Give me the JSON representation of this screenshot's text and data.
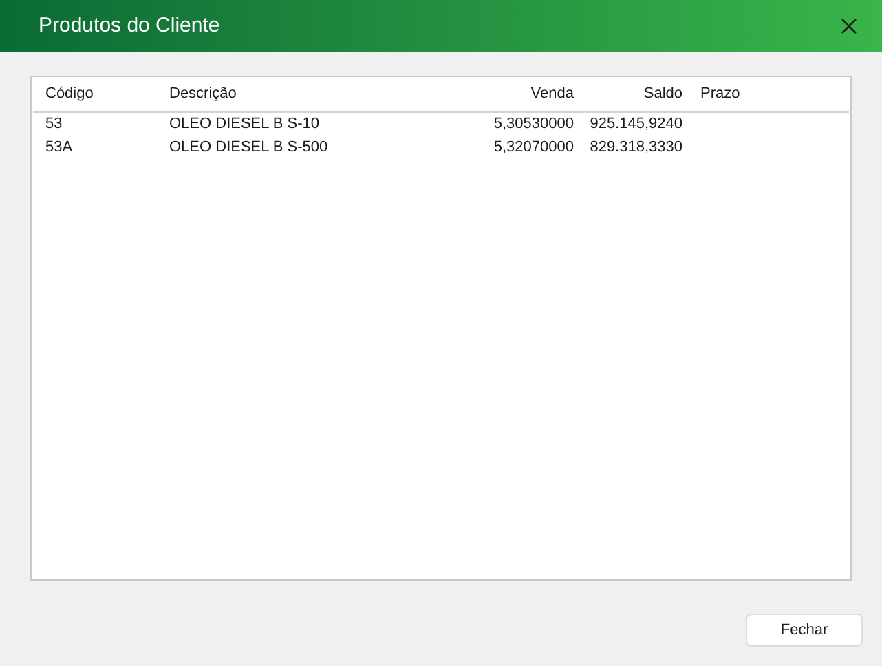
{
  "window": {
    "title": "Produtos do Cliente"
  },
  "table": {
    "columns": [
      "Código",
      "Descrição",
      "Venda",
      "Saldo",
      "Prazo"
    ],
    "rows": [
      [
        "53",
        "OLEO DIESEL B S-10",
        "5,30530000",
        "925.145,9240",
        ""
      ],
      [
        "53A",
        "OLEO DIESEL B S-500",
        "5,32070000",
        "829.318,3330",
        ""
      ]
    ]
  },
  "buttons": [
    "Fechar"
  ]
}
